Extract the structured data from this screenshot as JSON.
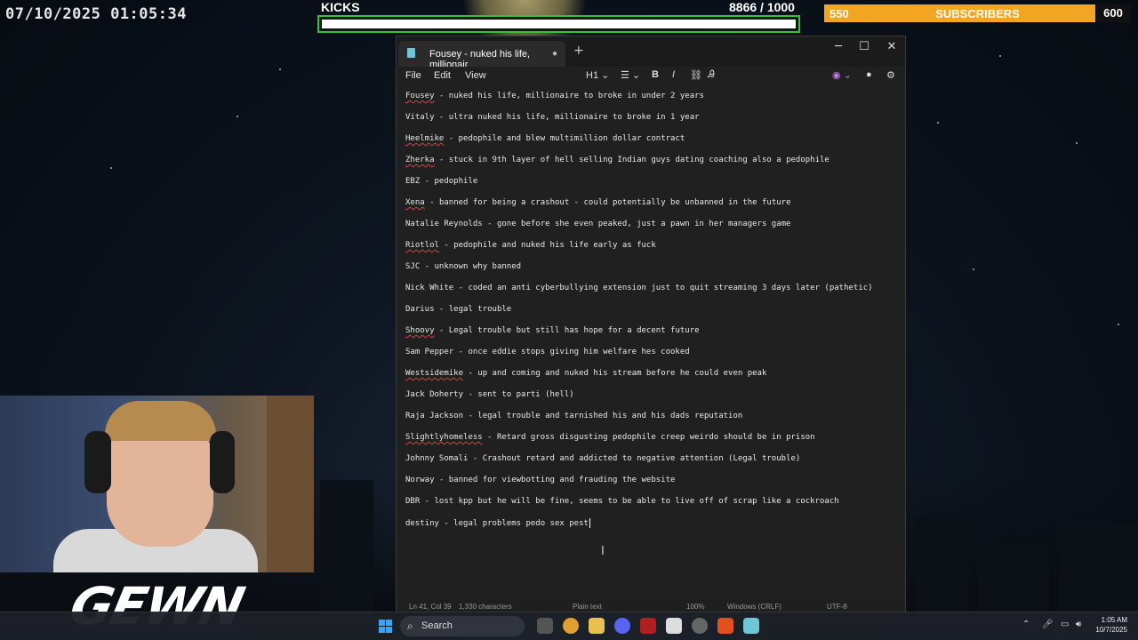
{
  "overlay": {
    "datetime": "07/10/2025 01:05:34",
    "kicks_label": "KICKS",
    "kicks_count": "8866 / 1000",
    "kicks_progress": 1.0,
    "subs_current": "550",
    "subs_label": "SUBSCRIBERS",
    "subs_goal": "600",
    "subs_color": "#f2a522",
    "kicks_border_color": "#39c03a",
    "streamer_logo": "GEWN"
  },
  "notepad": {
    "tab_title": "Fousey - nuked his life, millionair",
    "menu": [
      "File",
      "Edit",
      "View"
    ],
    "toolbar": {
      "heading": "H1",
      "list_icon": "list-icon",
      "bold": "B",
      "italic": "I",
      "link_icon": "link-icon",
      "clear_format_icon": "clear-format-icon"
    },
    "lines": [
      {
        "prefix": "",
        "flag": "Fousey",
        "rest": " - nuked his life, millionaire to broke in under 2 years"
      },
      {
        "prefix": "Vitaly - ultra nuked his life, millionaire to broke in 1 year",
        "flag": "",
        "rest": ""
      },
      {
        "prefix": "",
        "flag": "Heelmike",
        "rest": " - pedophile and blew multimillion dollar contract"
      },
      {
        "prefix": "",
        "flag": "Zherka",
        "rest": " - stuck in 9th layer of hell selling Indian guys dating coaching also a pedophile"
      },
      {
        "prefix": "EBZ - pedophile",
        "flag": "",
        "rest": ""
      },
      {
        "prefix": "",
        "flag": "Xena",
        "rest": " - banned for being a crashout - could potentially be unbanned in the future"
      },
      {
        "prefix": "Natalie Reynolds - gone before she even peaked, just a pawn in her managers game",
        "flag": "",
        "rest": ""
      },
      {
        "prefix": "",
        "flag": "Riotlol",
        "rest": " - pedophile and nuked his life early as fuck"
      },
      {
        "prefix": "SJC - unknown why banned",
        "flag": "",
        "rest": ""
      },
      {
        "prefix": "Nick White - coded an anti cyberbullying extension just to quit streaming 3 days later (pathetic)",
        "flag": "",
        "rest": ""
      },
      {
        "prefix": "Darius - legal trouble",
        "flag": "",
        "rest": ""
      },
      {
        "prefix": "",
        "flag": "Shoovy",
        "rest": " - Legal trouble but still has hope for a decent future"
      },
      {
        "prefix": "Sam Pepper - once eddie stops giving him welfare hes cooked",
        "flag": "",
        "rest": ""
      },
      {
        "prefix": "",
        "flag": "Westsidemike",
        "rest": " - up and coming and nuked his stream before he could even peak"
      },
      {
        "prefix": "Jack Doherty - sent to parti (hell)",
        "flag": "",
        "rest": ""
      },
      {
        "prefix": "Raja Jackson - legal trouble and tarnished his and his dads reputation",
        "flag": "",
        "rest": ""
      },
      {
        "prefix": "",
        "flag": "Slightlyhomeless",
        "rest": " - Retard gross disgusting pedophile creep weirdo should be in prison"
      },
      {
        "prefix": "Johnny Somali - Crashout retard and addicted to negative attention (Legal trouble)",
        "flag": "",
        "rest": ""
      },
      {
        "prefix": "Norway - banned for viewbotting and frauding the website",
        "flag": "",
        "rest": ""
      },
      {
        "prefix": "DBR - lost kpp but he will be fine, seems to be able to live off of scrap like a cockroach",
        "flag": "",
        "rest": ""
      },
      {
        "prefix": "destiny - legal problems pedo sex pest",
        "flag": "",
        "rest": ""
      }
    ],
    "status": {
      "position": "Ln 41, Col 39",
      "chars": "1,330 characters",
      "format": "Plain text",
      "zoom": "100%",
      "line_ending": "Windows (CRLF)",
      "encoding": "UTF-8"
    }
  },
  "taskbar": {
    "search_label": "Search",
    "time": "1:05 AM",
    "date": "10/7/2025"
  }
}
